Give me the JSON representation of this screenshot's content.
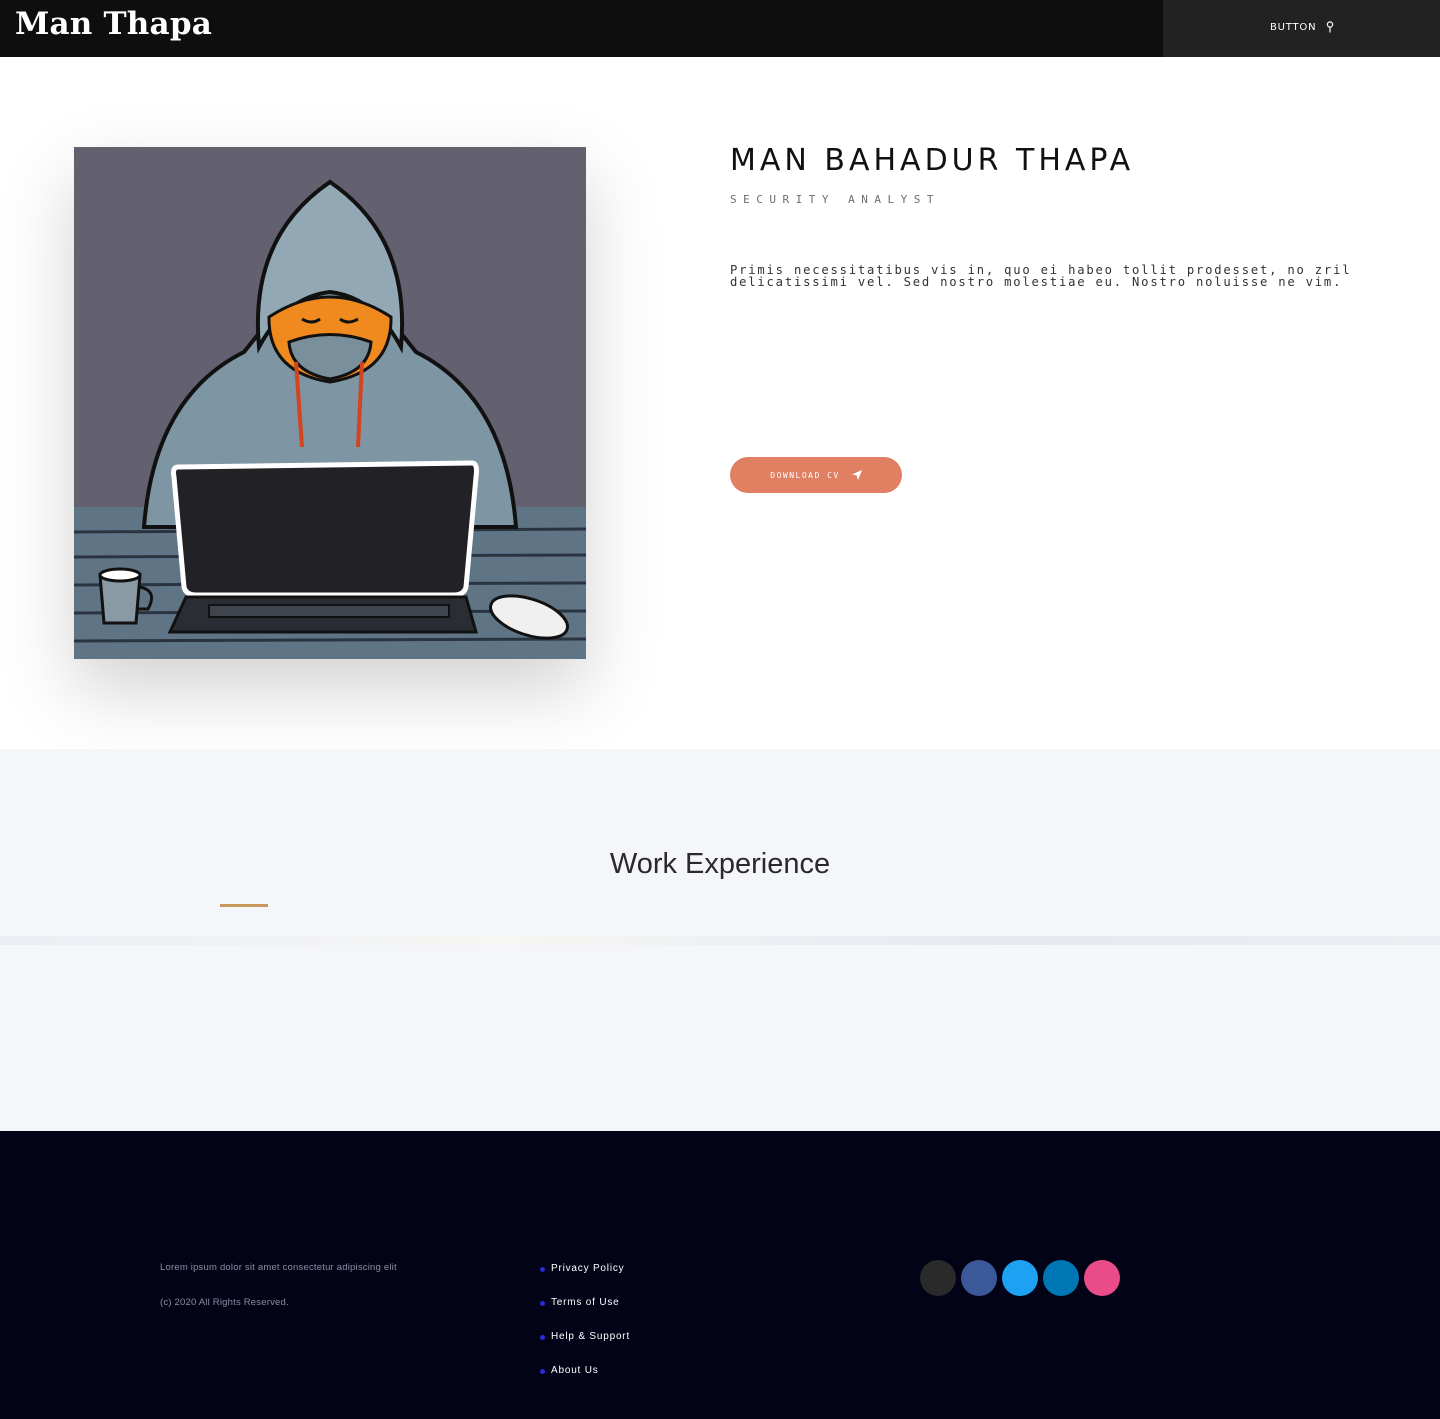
{
  "header": {
    "brand": "Man Thapa",
    "button_label": "BUTTON",
    "button_icon": "map-pin-icon"
  },
  "hero": {
    "name": "MAN BAHADUR THAPA",
    "role": "SECURITY ANALYST",
    "bio_line1": "Primis necessitatibus vis in, quo ei habeo tollit prodesset, no zril",
    "bio_line2": "delicatissimi vel. Sed nostro molestiae eu. Nostro noluisse ne vim.",
    "cv_button_label": "DOWNLOAD CV",
    "cv_button_icon": "paper-plane-icon",
    "cv_button_color": "#e07f61",
    "image_alt": "hooded-hacker-illustration"
  },
  "work": {
    "title": "Work Experience",
    "accent_color": "#c89a5b"
  },
  "footer": {
    "text": "Lorem ipsum dolor sit amet consectetur adipiscing elit",
    "copyright": "(c) 2020 All Rights Reserved.",
    "links": [
      {
        "label": "Privacy Policy"
      },
      {
        "label": "Terms of Use"
      },
      {
        "label": "Help & Support"
      },
      {
        "label": "About Us"
      }
    ],
    "socials": [
      {
        "name": "github-icon",
        "color": "#2a2a2a"
      },
      {
        "name": "facebook-icon",
        "color": "#3b5998"
      },
      {
        "name": "twitter-icon",
        "color": "#1da1f2"
      },
      {
        "name": "linkedin-icon",
        "color": "#0077b5"
      },
      {
        "name": "dribbble-icon",
        "color": "#ea4c89"
      }
    ]
  }
}
